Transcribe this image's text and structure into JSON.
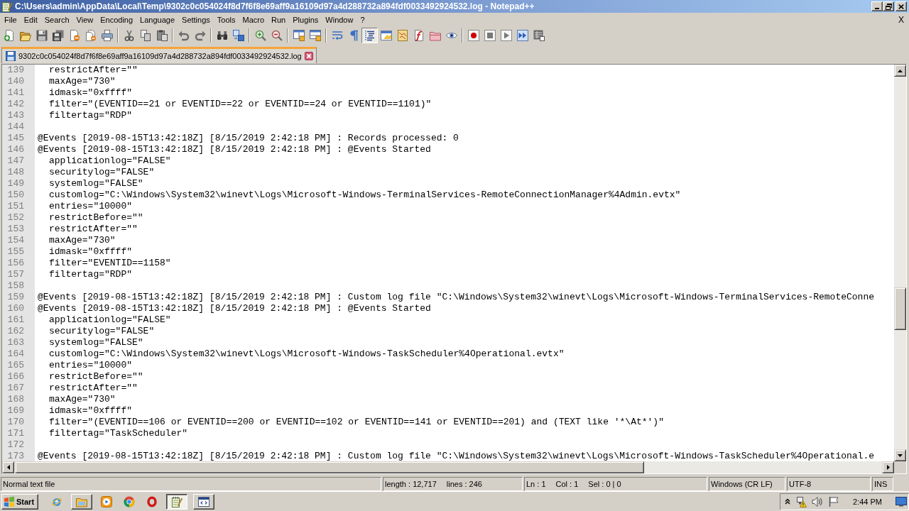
{
  "window": {
    "title": "C:\\Users\\admin\\AppData\\Local\\Temp\\9302c0c054024f8d7f6f8e69aff9a16109d97a4d288732a894fdf0033492924532.log - Notepad++"
  },
  "menu": {
    "items": [
      "File",
      "Edit",
      "Search",
      "View",
      "Encoding",
      "Language",
      "Settings",
      "Tools",
      "Macro",
      "Run",
      "Plugins",
      "Window",
      "?"
    ],
    "close_document": "X"
  },
  "toolbar": [
    [
      {
        "on": false
      },
      {
        "on": false
      },
      {
        "on": false
      },
      {
        "on": false
      },
      {
        "on": false
      },
      {
        "on": false
      },
      {
        "on": false
      }
    ],
    [
      {
        "on": false
      },
      {
        "on": false
      },
      {
        "on": false
      }
    ],
    [
      {
        "on": false
      },
      {
        "on": false
      }
    ],
    [
      {
        "on": false
      },
      {
        "on": false
      }
    ],
    [
      {
        "on": false
      },
      {
        "on": false
      }
    ],
    [
      {
        "on": false
      },
      {
        "on": false
      }
    ],
    [
      {
        "on": false
      },
      {
        "on": false
      },
      {
        "on": true
      },
      {
        "on": false
      },
      {
        "on": false
      },
      {
        "on": false
      },
      {
        "on": false
      },
      {
        "on": false
      }
    ],
    [
      {
        "on": false
      },
      {
        "on": false
      },
      {
        "on": false
      },
      {
        "on": false
      },
      {
        "on": false
      }
    ]
  ],
  "tabs": [
    {
      "label": "9302c0c054024f8d7f6f8e69aff9a16109d97a4d288732a894fdf0033492924532.log",
      "selected": true
    }
  ],
  "editor": {
    "lines": [
      {
        "number": "139",
        "kind": "setting",
        "text": "restrictAfter=\"\""
      },
      {
        "number": "140",
        "kind": "setting",
        "text": "maxAge=\"730\""
      },
      {
        "number": "141",
        "kind": "setting",
        "text": "idmask=\"0xffff\""
      },
      {
        "number": "142",
        "kind": "setting",
        "text": "filter=\"(EVENTID==21 or EVENTID==22 or EVENTID==24 or EVENTID==1101)\""
      },
      {
        "number": "143",
        "kind": "setting",
        "text": "filtertag=\"RDP\""
      },
      {
        "number": "144",
        "kind": "blank"
      },
      {
        "number": "145",
        "kind": "event",
        "text": "@Events [2019-08-15T13:42:18Z] [8/15/2019 2:42:18 PM] : Records processed: 0"
      },
      {
        "number": "146",
        "kind": "event",
        "text": "@Events [2019-08-15T13:42:18Z] [8/15/2019 2:42:18 PM] : @Events Started"
      },
      {
        "number": "147",
        "kind": "setting",
        "text": "applicationlog=\"FALSE\""
      },
      {
        "number": "148",
        "kind": "setting",
        "text": "securitylog=\"FALSE\""
      },
      {
        "number": "149",
        "kind": "setting",
        "text": "systemlog=\"FALSE\""
      },
      {
        "number": "150",
        "kind": "setting",
        "text": "customlog=\"C:\\Windows\\System32\\winevt\\Logs\\Microsoft-Windows-TerminalServices-RemoteConnectionManager%4Admin.evtx\""
      },
      {
        "number": "151",
        "kind": "setting",
        "text": "entries=\"10000\""
      },
      {
        "number": "152",
        "kind": "setting",
        "text": "restrictBefore=\"\""
      },
      {
        "number": "153",
        "kind": "setting",
        "text": "restrictAfter=\"\""
      },
      {
        "number": "154",
        "kind": "setting",
        "text": "maxAge=\"730\""
      },
      {
        "number": "155",
        "kind": "setting",
        "text": "idmask=\"0xffff\""
      },
      {
        "number": "156",
        "kind": "setting",
        "text": "filter=\"EVENTID==1158\""
      },
      {
        "number": "157",
        "kind": "setting",
        "text": "filtertag=\"RDP\""
      },
      {
        "number": "158",
        "kind": "blank"
      },
      {
        "number": "159",
        "kind": "event",
        "text": "@Events [2019-08-15T13:42:18Z] [8/15/2019 2:42:18 PM] : Custom log file \"C:\\Windows\\System32\\winevt\\Logs\\Microsoft-Windows-TerminalServices-RemoteConne"
      },
      {
        "number": "160",
        "kind": "event",
        "text": "@Events [2019-08-15T13:42:18Z] [8/15/2019 2:42:18 PM] : @Events Started"
      },
      {
        "number": "161",
        "kind": "setting",
        "text": "applicationlog=\"FALSE\""
      },
      {
        "number": "162",
        "kind": "setting",
        "text": "securitylog=\"FALSE\""
      },
      {
        "number": "163",
        "kind": "setting",
        "text": "systemlog=\"FALSE\""
      },
      {
        "number": "164",
        "kind": "setting",
        "text": "customlog=\"C:\\Windows\\System32\\winevt\\Logs\\Microsoft-Windows-TaskScheduler%4Operational.evtx\""
      },
      {
        "number": "165",
        "kind": "setting",
        "text": "entries=\"10000\""
      },
      {
        "number": "166",
        "kind": "setting",
        "text": "restrictBefore=\"\""
      },
      {
        "number": "167",
        "kind": "setting",
        "text": "restrictAfter=\"\""
      },
      {
        "number": "168",
        "kind": "setting",
        "text": "maxAge=\"730\""
      },
      {
        "number": "169",
        "kind": "setting",
        "text": "idmask=\"0xffff\""
      },
      {
        "number": "170",
        "kind": "setting",
        "text": "filter=\"(EVENTID==106 or EVENTID==200 or EVENTID==102 or EVENTID==141 or EVENTID==201) and (TEXT like '*\\At*')\""
      },
      {
        "number": "171",
        "kind": "setting",
        "text": "filtertag=\"TaskScheduler\""
      },
      {
        "number": "172",
        "kind": "blank"
      },
      {
        "number": "173",
        "kind": "event",
        "text": "@Events [2019-08-15T13:42:18Z] [8/15/2019 2:42:18 PM] : Custom log file \"C:\\Windows\\System32\\winevt\\Logs\\Microsoft-Windows-TaskScheduler%4Operational.e"
      }
    ]
  },
  "status_bar": {
    "file_type": "Normal text file",
    "length": "length : 12,717",
    "lines": "lines : 246",
    "position": "Ln : 1",
    "column": "Col : 1",
    "selection": "Sel : 0 | 0",
    "line_ending": "Windows (CR LF)",
    "encoding": "UTF-8",
    "mode": "INS"
  },
  "taskbar": {
    "start": "Start",
    "apps": [
      {
        "kind": "launcher",
        "selected": false
      },
      {
        "kind": "window",
        "selected": false
      },
      {
        "kind": "launcher",
        "selected": false
      },
      {
        "kind": "launcher",
        "selected": false
      },
      {
        "kind": "launcher",
        "selected": false
      },
      {
        "kind": "window",
        "selected": true
      },
      {
        "kind": "window",
        "selected": false
      }
    ],
    "clock": "2:44 PM"
  }
}
